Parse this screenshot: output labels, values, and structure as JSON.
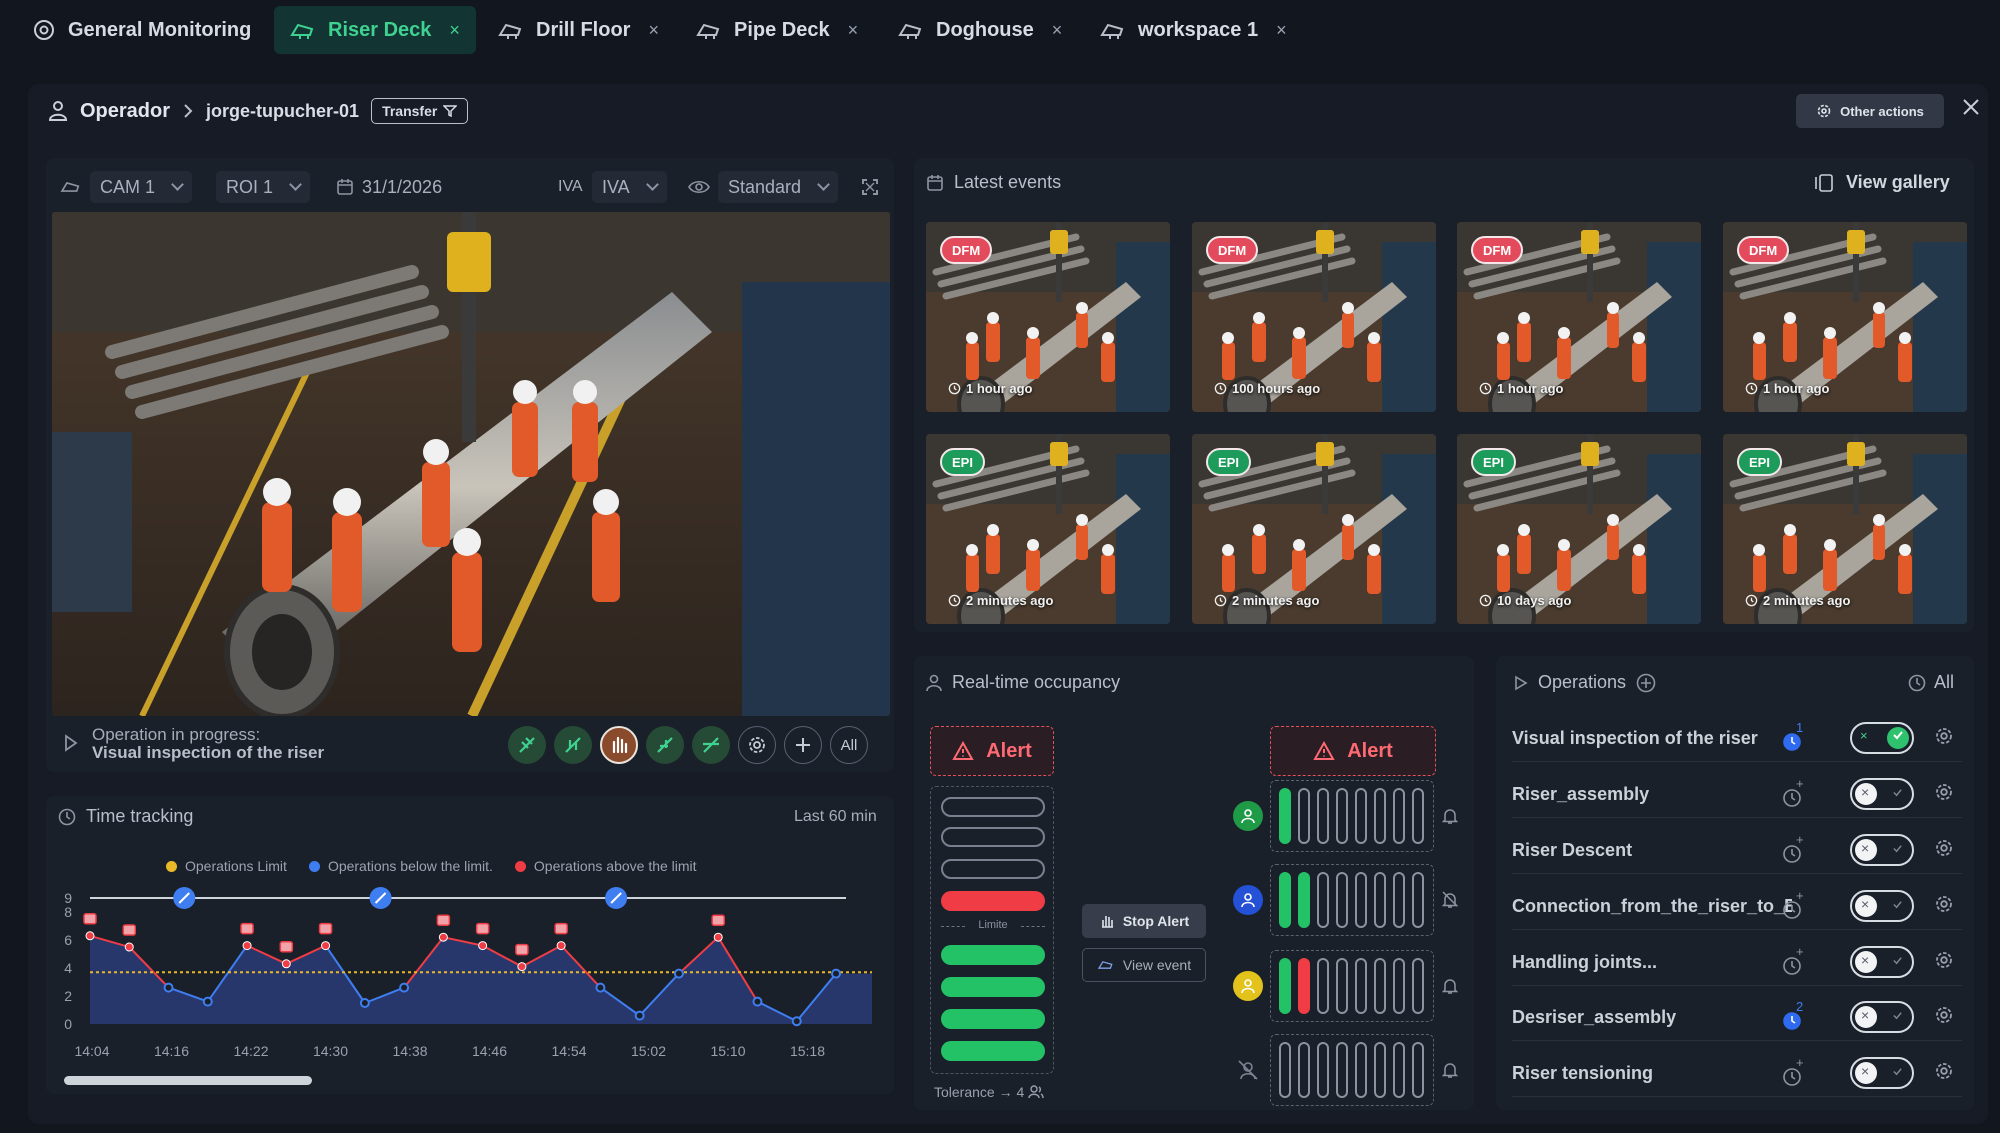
{
  "tabs": [
    {
      "label": "General Monitoring",
      "icon": "monitor-icon",
      "active": false,
      "closable": false
    },
    {
      "label": "Riser Deck",
      "icon": "crane-icon",
      "active": true,
      "closable": true
    },
    {
      "label": "Drill Floor",
      "icon": "crane-icon",
      "active": false,
      "closable": true
    },
    {
      "label": "Pipe Deck",
      "icon": "crane-icon",
      "active": false,
      "closable": true
    },
    {
      "label": "Doghouse",
      "icon": "crane-icon",
      "active": false,
      "closable": true
    },
    {
      "label": "workspace 1",
      "icon": "crane-icon",
      "active": false,
      "closable": true
    }
  ],
  "tab_close_glyph": "×",
  "breadcrumb": {
    "root": "Operador",
    "current": "jorge-tupucher-01",
    "transfer": "Transfer"
  },
  "other_actions": "Other actions",
  "camera": {
    "cam": "CAM 1",
    "roi": "ROI 1",
    "date": "31/1/2026",
    "iva_label": "IVA",
    "iva_value": "IVA",
    "view": "Standard"
  },
  "operation": {
    "status": "Operation in progress:",
    "name": "Visual inspection of the riser",
    "all": "All"
  },
  "time_tracking": {
    "title": "Time tracking",
    "range": "Last 60 min",
    "legend": [
      {
        "label": "Operations Limit",
        "color": "#e9b92a"
      },
      {
        "label": "Operations below the limit.",
        "color": "#3f7ef0"
      },
      {
        "label": "Operations above the limit",
        "color": "#ef3c45"
      }
    ]
  },
  "chart_data": {
    "type": "line",
    "x_ticks": [
      "14:04",
      "14:16",
      "14:22",
      "14:30",
      "14:38",
      "14:46",
      "14:54",
      "15:02",
      "15:10",
      "15:18"
    ],
    "y_ticks": [
      0,
      2,
      4,
      6,
      8,
      9
    ],
    "ylim": [
      0,
      9
    ],
    "limit": 3.7,
    "top_line": 9,
    "values": [
      6.3,
      5.5,
      2.6,
      1.6,
      5.6,
      4.3,
      5.6,
      1.5,
      2.6,
      6.2,
      5.6,
      4.1,
      5.6,
      2.6,
      0.6,
      3.6,
      6.2,
      1.6,
      0.2,
      3.6
    ],
    "markers_at": [
      2,
      7,
      13
    ],
    "series": [
      {
        "name": "Operations below the limit.",
        "color": "#3f7ef0"
      },
      {
        "name": "Operations above the limit",
        "color": "#ef3c45"
      }
    ]
  },
  "events": {
    "title": "Latest events",
    "view_gallery": "View gallery",
    "items": [
      {
        "badge": "DFM",
        "ago": "1 hour ago",
        "kind": "dfm"
      },
      {
        "badge": "DFM",
        "ago": "100 hours ago",
        "kind": "dfm"
      },
      {
        "badge": "DFM",
        "ago": "1 hour ago",
        "kind": "dfm"
      },
      {
        "badge": "DFM",
        "ago": "1 hour ago",
        "kind": "dfm"
      },
      {
        "badge": "EPI",
        "ago": "2 minutes ago",
        "kind": "epi"
      },
      {
        "badge": "EPI",
        "ago": "2 minutes ago",
        "kind": "epi"
      },
      {
        "badge": "EPI",
        "ago": "10 days ago",
        "kind": "epi"
      },
      {
        "badge": "EPI",
        "ago": "2 minutes ago",
        "kind": "epi"
      }
    ]
  },
  "occupancy": {
    "title": "Real-time occupancy",
    "alert": "Alert",
    "limit_label": "Limite",
    "stop_alert": "Stop Alert",
    "view_event": "View event",
    "tolerance": "Tolerance → 4",
    "column": [
      "empty",
      "empty",
      "empty",
      "red",
      "green",
      "green",
      "green",
      "green"
    ],
    "rows": [
      {
        "avatar_color": "#1f9b47",
        "bars": [
          "g",
          "e",
          "e",
          "e",
          "e",
          "e",
          "e",
          "e"
        ],
        "bell": "bell-icon"
      },
      {
        "avatar_color": "#2451d6",
        "bars": [
          "g",
          "g",
          "e",
          "e",
          "e",
          "e",
          "e",
          "e"
        ],
        "bell": "bell-off-icon"
      },
      {
        "avatar_color": "#e4c21c",
        "bars": [
          "g",
          "r",
          "e",
          "e",
          "e",
          "e",
          "e",
          "e"
        ],
        "bell": "bell-icon"
      },
      {
        "avatar_color": "none",
        "bars": [
          "e",
          "e",
          "e",
          "e",
          "e",
          "e",
          "e",
          "e"
        ],
        "bell": "bell-icon"
      }
    ]
  },
  "operations": {
    "title": "Operations",
    "all": "All",
    "items": [
      {
        "label": "Visual inspection of the riser",
        "count": "1",
        "on": true
      },
      {
        "label": "Riser_assembly",
        "count": "+",
        "on": false
      },
      {
        "label": "Riser Descent",
        "count": "+",
        "on": false
      },
      {
        "label": "Connection_from_the_riser_to_B",
        "count": "+",
        "on": false
      },
      {
        "label": "Handling joints...",
        "count": "+",
        "on": false
      },
      {
        "label": "Desriser_assembly",
        "count": "2",
        "on": false
      },
      {
        "label": "Riser tensioning",
        "count": "+",
        "on": false
      }
    ]
  },
  "colors": {
    "accent": "#3fd190",
    "alert": "#ef3c45",
    "ok": "#24c266"
  }
}
